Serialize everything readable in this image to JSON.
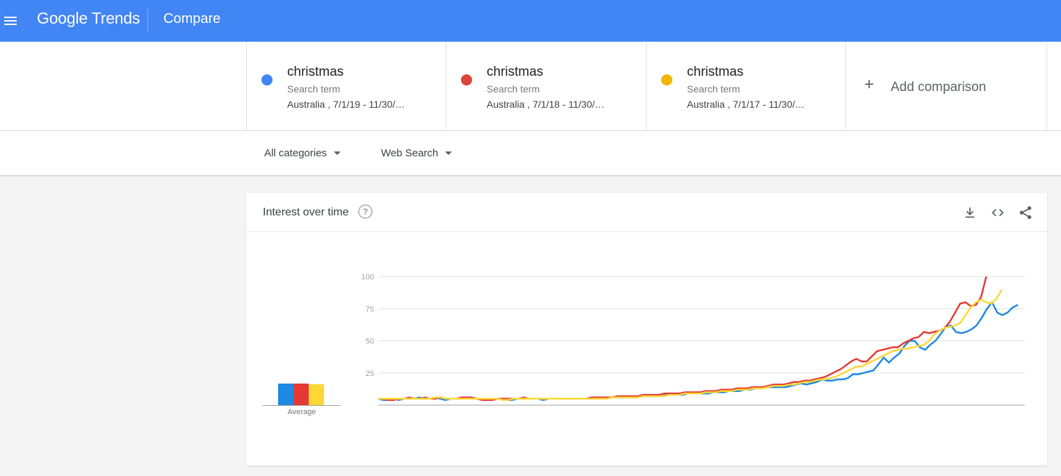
{
  "header": {
    "logo_text": "Google Trends",
    "page_title": "Compare",
    "bg_color": "#4285f4"
  },
  "terms": [
    {
      "name": "christmas",
      "type": "Search term",
      "region": "Australia , 7/1/19 - 11/30/…",
      "color": "#4285f4"
    },
    {
      "name": "christmas",
      "type": "Search term",
      "region": "Australia , 7/1/18 - 11/30/…",
      "color": "#db4437"
    },
    {
      "name": "christmas",
      "type": "Search term",
      "region": "Australia , 7/1/17 - 11/30/…",
      "color": "#f4b400"
    }
  ],
  "add_comparison": {
    "label": "Add comparison"
  },
  "filters": {
    "category": "All categories",
    "search_type": "Web Search"
  },
  "card": {
    "title": "Interest over time",
    "help_icon": "help-circle-icon",
    "actions": [
      "download-icon",
      "embed-code-icon",
      "share-icon"
    ]
  },
  "chart_data": {
    "type": "line",
    "title": "Interest over time",
    "xlabel": "",
    "ylabel": "",
    "ylim": [
      0,
      100
    ],
    "yticks": [
      25,
      50,
      75,
      100
    ],
    "grid": true,
    "series": [
      {
        "color": "#1e88e5",
        "values": [
          5,
          4,
          4,
          5,
          4,
          5,
          6,
          5,
          6,
          5,
          5,
          6,
          5,
          4,
          5,
          5,
          5,
          6,
          6,
          5,
          5,
          4,
          5,
          5,
          5,
          4,
          4,
          5,
          5,
          5,
          5,
          5,
          4,
          5,
          5,
          5,
          5,
          5,
          5,
          5,
          5,
          5,
          5,
          5,
          5,
          6,
          6,
          6,
          6,
          6,
          6,
          7,
          7,
          7,
          7,
          7,
          8,
          8,
          8,
          8,
          9,
          9,
          9,
          9,
          9,
          10,
          10,
          10,
          11,
          11,
          11,
          12,
          12,
          13,
          13,
          14,
          14,
          14,
          14,
          14,
          15,
          16,
          17,
          16,
          17,
          18,
          20,
          19,
          19,
          20,
          20,
          21,
          24,
          24,
          25,
          26,
          27,
          32,
          37,
          33,
          37,
          40,
          46,
          50,
          50,
          45,
          43,
          47,
          50,
          55,
          61,
          62,
          57,
          56,
          57,
          59,
          62,
          68,
          75,
          80,
          72,
          70,
          72,
          76,
          78
        ]
      },
      {
        "color": "#e53935",
        "values": [
          5,
          5,
          4,
          4,
          5,
          5,
          6,
          5,
          5,
          6,
          5,
          5,
          6,
          5,
          5,
          5,
          6,
          6,
          6,
          5,
          4,
          4,
          4,
          5,
          5,
          5,
          5,
          5,
          6,
          5,
          5,
          5,
          5,
          5,
          5,
          5,
          5,
          5,
          5,
          5,
          5,
          6,
          6,
          6,
          6,
          6,
          7,
          7,
          7,
          7,
          7,
          8,
          8,
          8,
          8,
          9,
          9,
          9,
          9,
          10,
          10,
          10,
          10,
          11,
          11,
          11,
          12,
          12,
          12,
          13,
          13,
          13,
          14,
          14,
          14,
          15,
          16,
          16,
          16,
          17,
          18,
          18,
          19,
          19,
          20,
          21,
          22,
          24,
          26,
          28,
          31,
          34,
          36,
          34,
          34,
          38,
          42,
          43,
          44,
          45,
          45,
          48,
          50,
          52,
          53,
          57,
          56,
          57,
          58,
          60,
          65,
          72,
          79,
          80,
          77,
          78,
          84,
          100
        ]
      },
      {
        "color": "#fdd835",
        "values": [
          5,
          5,
          5,
          5,
          5,
          5,
          5,
          5,
          5,
          5,
          5,
          6,
          6,
          5,
          5,
          5,
          5,
          5,
          5,
          5,
          5,
          5,
          5,
          5,
          4,
          4,
          5,
          5,
          5,
          5,
          5,
          5,
          5,
          5,
          5,
          5,
          5,
          5,
          5,
          5,
          5,
          5,
          5,
          5,
          5,
          6,
          6,
          6,
          6,
          6,
          6,
          7,
          7,
          7,
          7,
          7,
          8,
          8,
          8,
          9,
          9,
          9,
          9,
          10,
          10,
          10,
          11,
          11,
          11,
          12,
          12,
          12,
          13,
          13,
          13,
          14,
          15,
          15,
          15,
          16,
          16,
          17,
          18,
          18,
          19,
          20,
          20,
          21,
          22,
          24,
          26,
          28,
          30,
          30,
          32,
          34,
          36,
          38,
          40,
          42,
          43,
          44,
          44,
          45,
          46,
          47,
          50,
          55,
          58,
          60,
          61,
          62,
          64,
          70,
          76,
          80,
          82,
          80,
          79,
          83,
          90
        ]
      }
    ],
    "averages": [
      {
        "color": "#1e88e5",
        "value": 17
      },
      {
        "color": "#e53935",
        "value": 17
      },
      {
        "color": "#fdd835",
        "value": 16
      }
    ],
    "average_label": "Average"
  }
}
